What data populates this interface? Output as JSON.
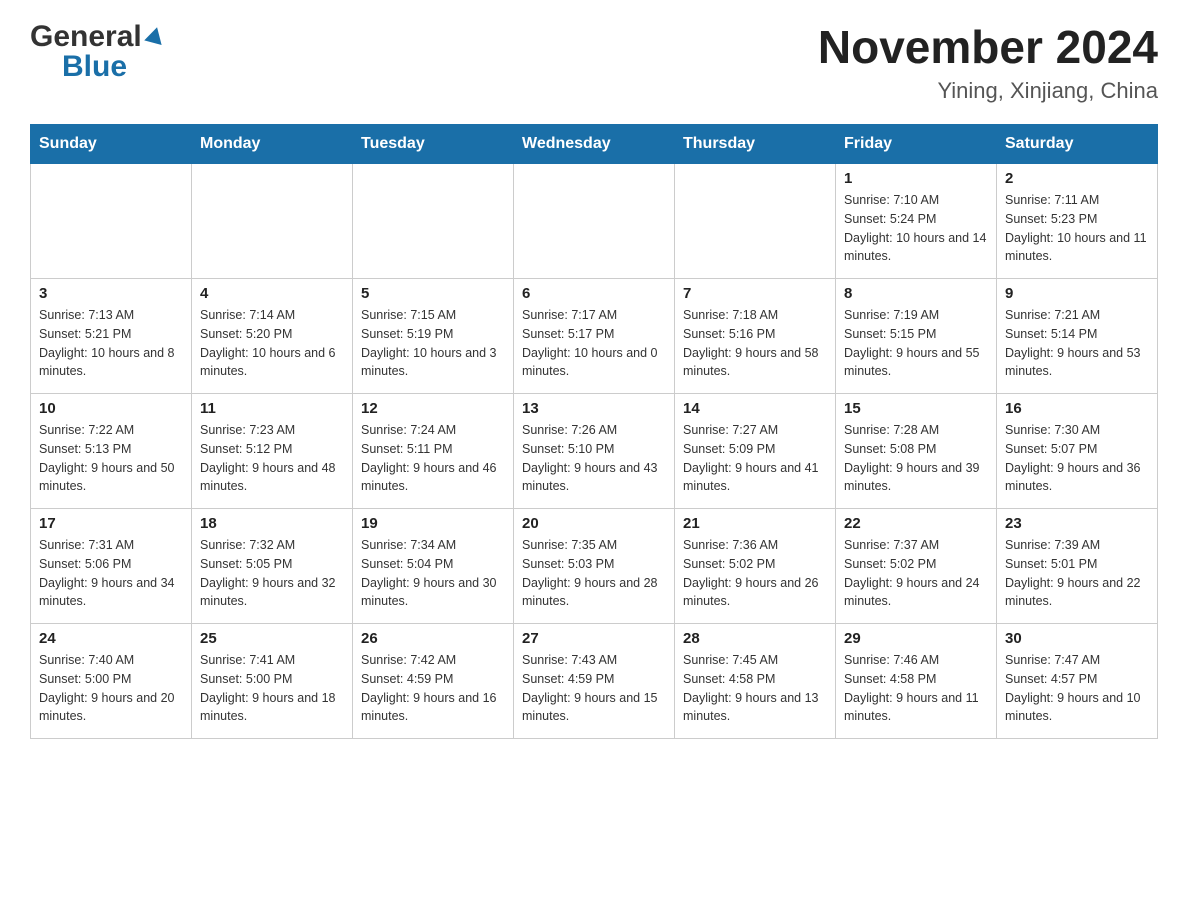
{
  "header": {
    "logo_general": "General",
    "logo_blue": "Blue",
    "title": "November 2024",
    "subtitle": "Yining, Xinjiang, China"
  },
  "days_of_week": [
    "Sunday",
    "Monday",
    "Tuesday",
    "Wednesday",
    "Thursday",
    "Friday",
    "Saturday"
  ],
  "weeks": [
    [
      {
        "day": "",
        "sunrise": "",
        "sunset": "",
        "daylight": ""
      },
      {
        "day": "",
        "sunrise": "",
        "sunset": "",
        "daylight": ""
      },
      {
        "day": "",
        "sunrise": "",
        "sunset": "",
        "daylight": ""
      },
      {
        "day": "",
        "sunrise": "",
        "sunset": "",
        "daylight": ""
      },
      {
        "day": "",
        "sunrise": "",
        "sunset": "",
        "daylight": ""
      },
      {
        "day": "1",
        "sunrise": "Sunrise: 7:10 AM",
        "sunset": "Sunset: 5:24 PM",
        "daylight": "Daylight: 10 hours and 14 minutes."
      },
      {
        "day": "2",
        "sunrise": "Sunrise: 7:11 AM",
        "sunset": "Sunset: 5:23 PM",
        "daylight": "Daylight: 10 hours and 11 minutes."
      }
    ],
    [
      {
        "day": "3",
        "sunrise": "Sunrise: 7:13 AM",
        "sunset": "Sunset: 5:21 PM",
        "daylight": "Daylight: 10 hours and 8 minutes."
      },
      {
        "day": "4",
        "sunrise": "Sunrise: 7:14 AM",
        "sunset": "Sunset: 5:20 PM",
        "daylight": "Daylight: 10 hours and 6 minutes."
      },
      {
        "day": "5",
        "sunrise": "Sunrise: 7:15 AM",
        "sunset": "Sunset: 5:19 PM",
        "daylight": "Daylight: 10 hours and 3 minutes."
      },
      {
        "day": "6",
        "sunrise": "Sunrise: 7:17 AM",
        "sunset": "Sunset: 5:17 PM",
        "daylight": "Daylight: 10 hours and 0 minutes."
      },
      {
        "day": "7",
        "sunrise": "Sunrise: 7:18 AM",
        "sunset": "Sunset: 5:16 PM",
        "daylight": "Daylight: 9 hours and 58 minutes."
      },
      {
        "day": "8",
        "sunrise": "Sunrise: 7:19 AM",
        "sunset": "Sunset: 5:15 PM",
        "daylight": "Daylight: 9 hours and 55 minutes."
      },
      {
        "day": "9",
        "sunrise": "Sunrise: 7:21 AM",
        "sunset": "Sunset: 5:14 PM",
        "daylight": "Daylight: 9 hours and 53 minutes."
      }
    ],
    [
      {
        "day": "10",
        "sunrise": "Sunrise: 7:22 AM",
        "sunset": "Sunset: 5:13 PM",
        "daylight": "Daylight: 9 hours and 50 minutes."
      },
      {
        "day": "11",
        "sunrise": "Sunrise: 7:23 AM",
        "sunset": "Sunset: 5:12 PM",
        "daylight": "Daylight: 9 hours and 48 minutes."
      },
      {
        "day": "12",
        "sunrise": "Sunrise: 7:24 AM",
        "sunset": "Sunset: 5:11 PM",
        "daylight": "Daylight: 9 hours and 46 minutes."
      },
      {
        "day": "13",
        "sunrise": "Sunrise: 7:26 AM",
        "sunset": "Sunset: 5:10 PM",
        "daylight": "Daylight: 9 hours and 43 minutes."
      },
      {
        "day": "14",
        "sunrise": "Sunrise: 7:27 AM",
        "sunset": "Sunset: 5:09 PM",
        "daylight": "Daylight: 9 hours and 41 minutes."
      },
      {
        "day": "15",
        "sunrise": "Sunrise: 7:28 AM",
        "sunset": "Sunset: 5:08 PM",
        "daylight": "Daylight: 9 hours and 39 minutes."
      },
      {
        "day": "16",
        "sunrise": "Sunrise: 7:30 AM",
        "sunset": "Sunset: 5:07 PM",
        "daylight": "Daylight: 9 hours and 36 minutes."
      }
    ],
    [
      {
        "day": "17",
        "sunrise": "Sunrise: 7:31 AM",
        "sunset": "Sunset: 5:06 PM",
        "daylight": "Daylight: 9 hours and 34 minutes."
      },
      {
        "day": "18",
        "sunrise": "Sunrise: 7:32 AM",
        "sunset": "Sunset: 5:05 PM",
        "daylight": "Daylight: 9 hours and 32 minutes."
      },
      {
        "day": "19",
        "sunrise": "Sunrise: 7:34 AM",
        "sunset": "Sunset: 5:04 PM",
        "daylight": "Daylight: 9 hours and 30 minutes."
      },
      {
        "day": "20",
        "sunrise": "Sunrise: 7:35 AM",
        "sunset": "Sunset: 5:03 PM",
        "daylight": "Daylight: 9 hours and 28 minutes."
      },
      {
        "day": "21",
        "sunrise": "Sunrise: 7:36 AM",
        "sunset": "Sunset: 5:02 PM",
        "daylight": "Daylight: 9 hours and 26 minutes."
      },
      {
        "day": "22",
        "sunrise": "Sunrise: 7:37 AM",
        "sunset": "Sunset: 5:02 PM",
        "daylight": "Daylight: 9 hours and 24 minutes."
      },
      {
        "day": "23",
        "sunrise": "Sunrise: 7:39 AM",
        "sunset": "Sunset: 5:01 PM",
        "daylight": "Daylight: 9 hours and 22 minutes."
      }
    ],
    [
      {
        "day": "24",
        "sunrise": "Sunrise: 7:40 AM",
        "sunset": "Sunset: 5:00 PM",
        "daylight": "Daylight: 9 hours and 20 minutes."
      },
      {
        "day": "25",
        "sunrise": "Sunrise: 7:41 AM",
        "sunset": "Sunset: 5:00 PM",
        "daylight": "Daylight: 9 hours and 18 minutes."
      },
      {
        "day": "26",
        "sunrise": "Sunrise: 7:42 AM",
        "sunset": "Sunset: 4:59 PM",
        "daylight": "Daylight: 9 hours and 16 minutes."
      },
      {
        "day": "27",
        "sunrise": "Sunrise: 7:43 AM",
        "sunset": "Sunset: 4:59 PM",
        "daylight": "Daylight: 9 hours and 15 minutes."
      },
      {
        "day": "28",
        "sunrise": "Sunrise: 7:45 AM",
        "sunset": "Sunset: 4:58 PM",
        "daylight": "Daylight: 9 hours and 13 minutes."
      },
      {
        "day": "29",
        "sunrise": "Sunrise: 7:46 AM",
        "sunset": "Sunset: 4:58 PM",
        "daylight": "Daylight: 9 hours and 11 minutes."
      },
      {
        "day": "30",
        "sunrise": "Sunrise: 7:47 AM",
        "sunset": "Sunset: 4:57 PM",
        "daylight": "Daylight: 9 hours and 10 minutes."
      }
    ]
  ]
}
